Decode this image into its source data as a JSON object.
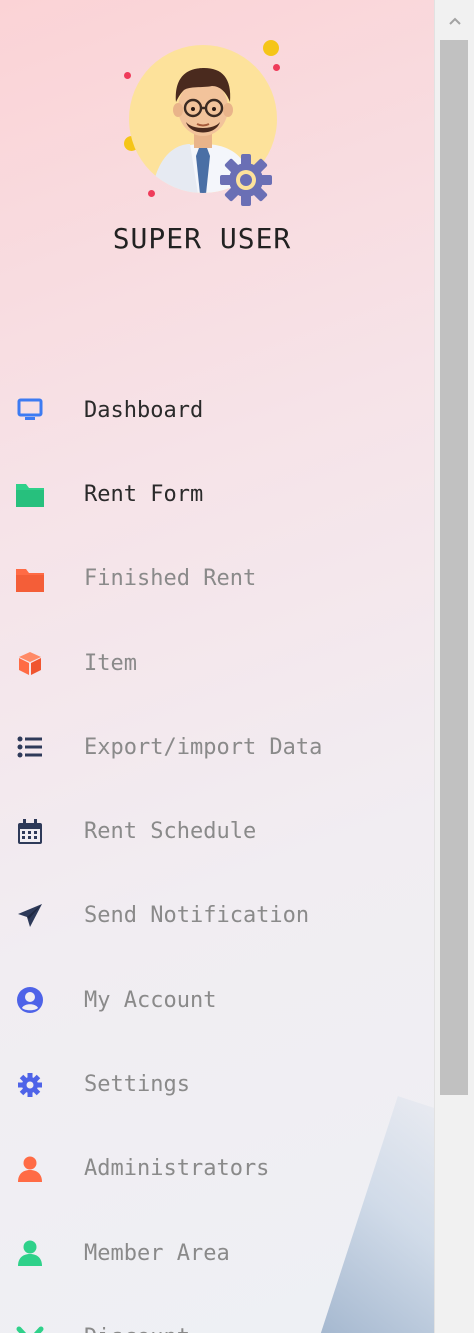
{
  "user": {
    "name": "SUPER USER"
  },
  "menu": [
    {
      "label": "Dashboard",
      "icon": "monitor-icon",
      "color": "#3d7bf2",
      "active": true
    },
    {
      "label": "Rent Form",
      "icon": "folder-icon",
      "color": "#2fd18a",
      "active": true
    },
    {
      "label": "Finished Rent",
      "icon": "folder-icon",
      "color": "#ff6b45",
      "active": false
    },
    {
      "label": "Item",
      "icon": "box-icon",
      "color": "#ff6b45",
      "active": false
    },
    {
      "label": "Export/import Data",
      "icon": "list-icon",
      "color": "#2e3a59",
      "active": false
    },
    {
      "label": "Rent Schedule",
      "icon": "calendar-icon",
      "color": "#2e3a59",
      "active": false
    },
    {
      "label": "Send Notification",
      "icon": "paper-plane-icon",
      "color": "#2e3a59",
      "active": false
    },
    {
      "label": "My Account",
      "icon": "user-circle-icon",
      "color": "#4e63e8",
      "active": false
    },
    {
      "label": "Settings",
      "icon": "gear-icon",
      "color": "#4e63e8",
      "active": false
    },
    {
      "label": "Administrators",
      "icon": "user-icon",
      "color": "#ff6b45",
      "active": false
    },
    {
      "label": "Member Area",
      "icon": "user-icon",
      "color": "#2fd18a",
      "active": false
    },
    {
      "label": "Discount",
      "icon": "check-icon",
      "color": "#2fd18a",
      "active": false
    }
  ]
}
